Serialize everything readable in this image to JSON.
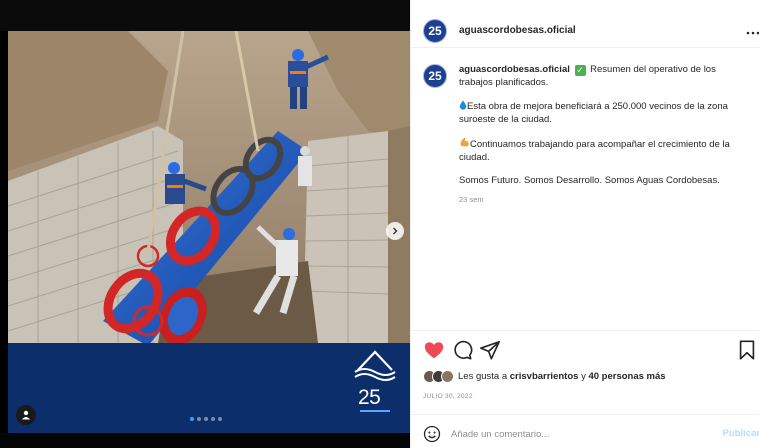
{
  "post": {
    "username": "aguascordobesas.oficial",
    "avatar_text": "25",
    "more_icon": "more-horizontal-icon"
  },
  "media": {
    "brand_number": "25",
    "carousel": {
      "count": 5,
      "active_index": 0
    }
  },
  "caption": {
    "username": "aguascordobesas.oficial",
    "check_emoji": "✓",
    "line1": "Resumen del operativo de los trabajos planificados.",
    "drop_emoji": "💧",
    "line2": "Esta obra de mejora beneficiará a 250.000 vecinos de la zona suroeste de la ciudad.",
    "flex_emoji": "💪",
    "line3": "Continuamos trabajando para acompañar el crecimiento de la ciudad.",
    "line4": "Somos Futuro. Somos Desarrollo. Somos Aguas Cordobesas.",
    "time": "23 sem"
  },
  "actions": {
    "liked": true,
    "icons": [
      "heart-icon",
      "comment-icon",
      "share-icon",
      "bookmark-icon"
    ]
  },
  "likes": {
    "prefix": "Les gusta a",
    "user": "crisvbarrientos",
    "connector": "y",
    "others": "40 personas más"
  },
  "date": "JULIO 30, 2022",
  "comment": {
    "placeholder": "Añade un comentario...",
    "publish": "Publicar"
  },
  "colors": {
    "brand_blue": "#0c2f6b",
    "like_red": "#ed4956",
    "link_blue": "#b2dffc",
    "active_dot": "#3b9df5"
  }
}
